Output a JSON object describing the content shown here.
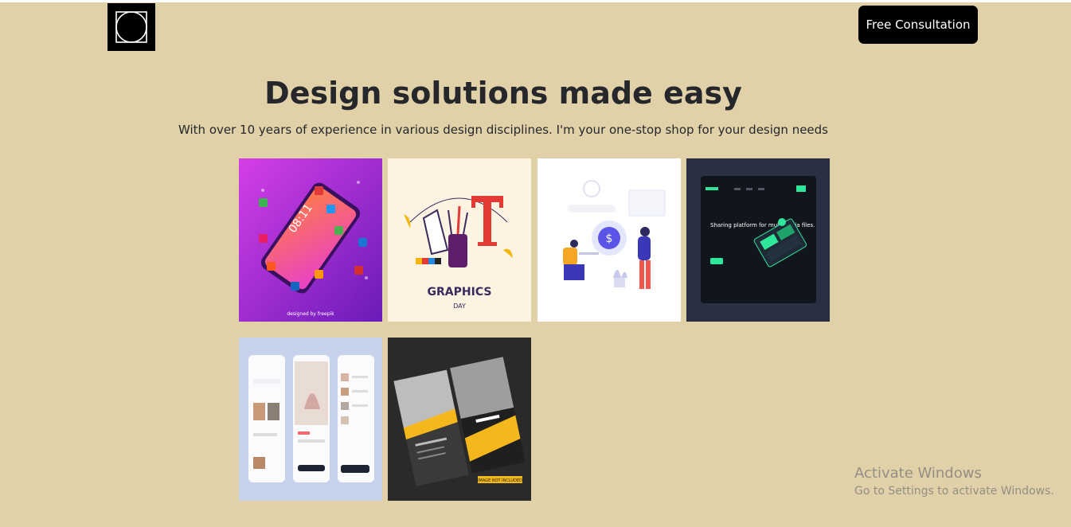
{
  "header": {
    "logo_icon": "square-circle-logo-icon",
    "cta_label": "Free Consultation"
  },
  "hero": {
    "title": "Design solutions made easy",
    "subtitle": "With over 10 years of experience in various design disciplines. I'm your one-stop shop for your design needs"
  },
  "gallery": {
    "items": [
      {
        "subject": "social-media-phone-illustration",
        "text": "08:11",
        "credit": "designed by freepik"
      },
      {
        "subject": "graphics-day-illustration",
        "title": "GRAPHICS",
        "sub": "DAY"
      },
      {
        "subject": "finance-people-illustration"
      },
      {
        "subject": "dark-landing-page-mockup",
        "text": "Sharing platform for multimedia files."
      },
      {
        "subject": "mobile-app-screens-mockup"
      },
      {
        "subject": "business-card-mockup",
        "text": "IMAGE NOT INCLUDED"
      }
    ]
  },
  "watermark": {
    "line1": "Activate Windows",
    "line2": "Go to Settings to activate Windows."
  },
  "colors": {
    "background": "#e1d1a9",
    "button_bg": "#000000",
    "button_text": "#ffffff",
    "heading": "#26272b"
  }
}
